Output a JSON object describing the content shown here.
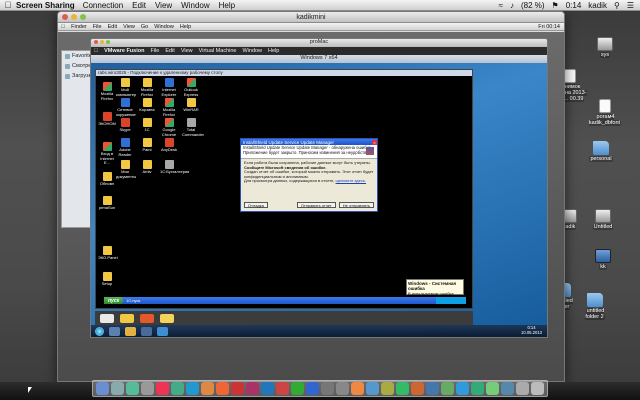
{
  "menubar": {
    "app": "Screen Sharing",
    "items": [
      "Connection",
      "Edit",
      "View",
      "Window",
      "Help"
    ],
    "battery": "(82 %)",
    "clock": "0:14",
    "user": "kadik"
  },
  "ss_window": {
    "title": "kadikmini"
  },
  "remote_menubar": {
    "items": [
      "Finder",
      "File",
      "Edit",
      "View",
      "Go",
      "Window",
      "Help"
    ],
    "clock": "Fri 00:14"
  },
  "finder": {
    "items": [
      "Favorites",
      "Смотреть",
      "Загрузки"
    ]
  },
  "vmware": {
    "title": "proMac",
    "app": "VMware Fusion",
    "menu": [
      "File",
      "Edit",
      "View",
      "Virtual Machine",
      "Window",
      "Help"
    ]
  },
  "win7": {
    "title": "Windows 7 x64",
    "rdp_title": "rabs.wiro3025 - Подключение к удаленному рабочему столу",
    "clock_time": "0:14",
    "clock_date": "10.05.2013"
  },
  "xp": {
    "start_label": "пуск",
    "icons": [
      {
        "label": "Мой компьютер"
      },
      {
        "label": "Internet Explorer"
      },
      {
        "label": "Mozilla Firefox"
      },
      {
        "label": "Сетевое окружение"
      },
      {
        "label": "Корзина"
      },
      {
        "label": "Outlook Express"
      },
      {
        "label": "Google Chrome"
      },
      {
        "label": "Opera"
      },
      {
        "label": "Skype"
      },
      {
        "label": "1C"
      },
      {
        "label": "WinRAR"
      },
      {
        "label": "Total Commander"
      },
      {
        "label": "Adobe Reader"
      },
      {
        "label": "Paint"
      },
      {
        "label": "Internet Explorer"
      },
      {
        "label": "AnyDesk"
      },
      {
        "label": "Мои документы"
      },
      {
        "label": "Arhiv"
      },
      {
        "label": "ЭЦП"
      },
      {
        "label": "1C:Бухгалтерия"
      }
    ],
    "left_icons": [
      {
        "label": "Mozilla Firefox"
      },
      {
        "label": "ЭКОНОМ"
      },
      {
        "label": "Вход в Internet E..."
      },
      {
        "label": "Обновл"
      },
      {
        "label": "prmaSun"
      },
      {
        "label": "ЭКО.Panel"
      },
      {
        "label": "Setup"
      }
    ],
    "taskbar_item": "1С:пуск",
    "balloon_title": "Windows - Системная ошибка",
    "balloon_text": "В используемом ошибка"
  },
  "dialog": {
    "title": "InstallShield Update Service Update Manager",
    "head": "InstallShield Update Service Update Manager - обнаружена ошибка. Приложение будет закрыто. Приносим извинения за неудобство.",
    "body1": "Если работа была сохранена, рабочие данные могут быть утеряны.",
    "bold": "Сообщите Microsoft сведения об ошибке.",
    "body2": "Создан отчет об ошибке, который можно отправить. Этот отчет будет конфиденциальным и анонимным.",
    "body3": "Для просмотра данных, содержащихся в отчете,",
    "link": "щелкните здесь.",
    "btn_debug": "Отладка",
    "btn_send": "Отправить отчет",
    "btn_nosend": "Не отправлять"
  },
  "desktop_icons": [
    {
      "label": "sys"
    },
    {
      "label": "Снимок экрана 2013-05-... 00.39"
    },
    {
      "label": "рогам4 kadik_dbfont"
    },
    {
      "label": "personal"
    },
    {
      "label": "kadik"
    },
    {
      "label": "Untitled"
    },
    {
      "label": "kk"
    },
    {
      "label": "Untitled folder"
    },
    {
      "label": "untitled folder 2"
    }
  ],
  "colors": {
    "xp_taskbar": "#1d58cf",
    "xp_start": "#2f8a2d",
    "dialog_title": "#1f52c7",
    "win7_bg": "#3a86c8"
  }
}
